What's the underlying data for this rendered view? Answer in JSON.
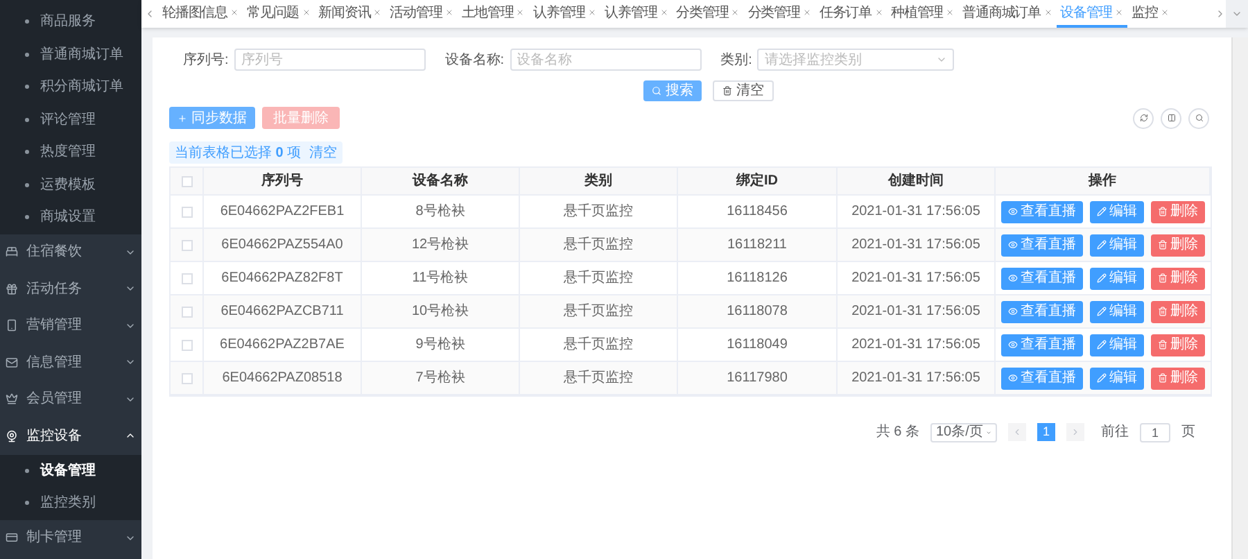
{
  "sidebar": {
    "partial_group_items": [
      {
        "label": "商品服务",
        "selected": false
      },
      {
        "label": "普通商城订单",
        "selected": false
      },
      {
        "label": "积分商城订单",
        "selected": false
      },
      {
        "label": "评论管理",
        "selected": false
      },
      {
        "label": "热度管理",
        "selected": false
      },
      {
        "label": "运费模板",
        "selected": false
      },
      {
        "label": "商城设置",
        "selected": false
      }
    ],
    "groups": [
      {
        "label": "住宿餐饮",
        "expanded": false
      },
      {
        "label": "活动任务",
        "expanded": false
      },
      {
        "label": "营销管理",
        "expanded": false
      },
      {
        "label": "信息管理",
        "expanded": false
      },
      {
        "label": "会员管理",
        "expanded": false
      },
      {
        "label": "监控设备",
        "expanded": true,
        "children": [
          {
            "label": "设备管理",
            "selected": true
          },
          {
            "label": "监控类别",
            "selected": false
          }
        ]
      },
      {
        "label": "制卡管理",
        "expanded": false
      }
    ]
  },
  "tabs": [
    {
      "label": "轮播图信息",
      "selected": false
    },
    {
      "label": "常见问题",
      "selected": false
    },
    {
      "label": "新闻资讯",
      "selected": false
    },
    {
      "label": "活动管理",
      "selected": false
    },
    {
      "label": "土地管理",
      "selected": false
    },
    {
      "label": "认养管理",
      "selected": false
    },
    {
      "label": "认养管理",
      "selected": false
    },
    {
      "label": "分类管理",
      "selected": false
    },
    {
      "label": "分类管理",
      "selected": false
    },
    {
      "label": "任务订单",
      "selected": false
    },
    {
      "label": "种植管理",
      "selected": false
    },
    {
      "label": "普通商城订单",
      "selected": false
    },
    {
      "label": "设备管理",
      "selected": true
    },
    {
      "label": "监控",
      "selected": false
    }
  ],
  "filters": [
    {
      "label": "序列号:",
      "placeholder": "序列号",
      "kind": "input"
    },
    {
      "label": "设备名称:",
      "placeholder": "设备名称",
      "kind": "input"
    },
    {
      "label": "类别:",
      "placeholder": "请选择监控类别",
      "kind": "select"
    }
  ],
  "search_button": "搜索",
  "clear_button": "清空",
  "sync_button": "同步数据",
  "batch_delete": {
    "label": "批量删除",
    "disabled": true
  },
  "selection_info": {
    "prefix": "当前表格已选择",
    "count": "0",
    "suffix": "项",
    "clear": "清空"
  },
  "table": {
    "header_checked": false,
    "columns": [
      "序列号",
      "设备名称",
      "类别",
      "绑定ID",
      "创建时间",
      "操作"
    ],
    "rows": [
      {
        "checked": false,
        "cells": [
          "6E04662PAZ2FEB1",
          "8号枪袂",
          "悬千页监控",
          "16118456",
          "2021-01-31 17:56:05"
        ],
        "actions": [
          {
            "label": "查看直播",
            "kind": "view"
          },
          {
            "label": "编辑",
            "kind": "edit"
          },
          {
            "label": "删除",
            "kind": "delete"
          }
        ]
      },
      {
        "checked": false,
        "cells": [
          "6E04662PAZ554A0",
          "12号枪袂",
          "悬千页监控",
          "16118211",
          "2021-01-31 17:56:05"
        ],
        "actions": [
          {
            "label": "查看直播",
            "kind": "view"
          },
          {
            "label": "编辑",
            "kind": "edit"
          },
          {
            "label": "删除",
            "kind": "delete"
          }
        ]
      },
      {
        "checked": false,
        "cells": [
          "6E04662PAZ82F8T",
          "11号枪袂",
          "悬千页监控",
          "16118126",
          "2021-01-31 17:56:05"
        ],
        "actions": [
          {
            "label": "查看直播",
            "kind": "view"
          },
          {
            "label": "编辑",
            "kind": "edit"
          },
          {
            "label": "删除",
            "kind": "delete"
          }
        ]
      },
      {
        "checked": false,
        "cells": [
          "6E04662PAZCB711",
          "10号枪袂",
          "悬千页监控",
          "16118078",
          "2021-01-31 17:56:05"
        ],
        "actions": [
          {
            "label": "查看直播",
            "kind": "view"
          },
          {
            "label": "编辑",
            "kind": "edit"
          },
          {
            "label": "删除",
            "kind": "delete"
          }
        ]
      },
      {
        "checked": false,
        "cells": [
          "6E04662PAZ2B7AE",
          "9号枪袂",
          "悬千页监控",
          "16118049",
          "2021-01-31 17:56:05"
        ],
        "actions": [
          {
            "label": "查看直播",
            "kind": "view"
          },
          {
            "label": "编辑",
            "kind": "edit"
          },
          {
            "label": "删除",
            "kind": "delete"
          }
        ]
      },
      {
        "checked": false,
        "cells": [
          "6E04662PAZ08518",
          "7号枪袂",
          "悬千页监控",
          "16117980",
          "2021-01-31 17:56:05"
        ],
        "actions": [
          {
            "label": "查看直播",
            "kind": "view"
          },
          {
            "label": "编辑",
            "kind": "edit"
          },
          {
            "label": "删除",
            "kind": "delete"
          }
        ]
      }
    ]
  },
  "pagination": {
    "total": "共 6 条",
    "page_size": "10条/页",
    "pages": [
      {
        "label": "1",
        "selected": true
      }
    ],
    "goto_label": "前往",
    "goto_value": "1",
    "goto_suffix": "页"
  }
}
